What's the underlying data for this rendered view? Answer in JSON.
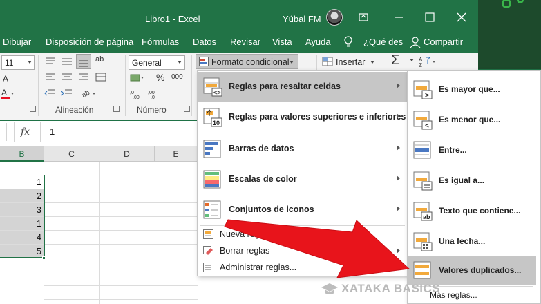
{
  "titlebar": {
    "title": "Libro1  -  Excel",
    "user": "Yúbal FM"
  },
  "tabs": [
    "Dibujar",
    "Disposición de página",
    "Fórmulas",
    "Datos",
    "Revisar",
    "Vista",
    "Ayuda",
    "¿Qué des",
    "Compartir"
  ],
  "ribbon": {
    "font_size": "11",
    "number_format": "General",
    "percent": "%",
    "thousands": "000",
    "ab_label": "ab",
    "group_alignment": "Alineación",
    "group_number": "Número",
    "cond_format_label": "Formato condicional",
    "insert_label": "Insertar",
    "sum_symbol": "Σ"
  },
  "formula_bar": {
    "fx": "fx",
    "value": "1"
  },
  "grid": {
    "columns": [
      "B",
      "C",
      "D",
      "E"
    ],
    "values": [
      "1",
      "2",
      "3",
      "1",
      "4",
      "5"
    ]
  },
  "menu1": {
    "items": [
      {
        "label": "Reglas para resaltar celdas",
        "icon": "highlight-rules-icon"
      },
      {
        "label": "Reglas para valores superiores e inferiores",
        "icon": "top-bottom-rules-icon"
      },
      {
        "label": "Barras de datos",
        "icon": "data-bars-icon"
      },
      {
        "label": "Escalas de color",
        "icon": "color-scales-icon"
      },
      {
        "label": "Conjuntos de iconos",
        "icon": "icon-sets-icon"
      }
    ],
    "small_items": [
      {
        "label": "Nueva regla...",
        "icon": "new-rule-icon"
      },
      {
        "label": "Borrar reglas",
        "icon": "clear-rules-icon"
      },
      {
        "label": "Administrar reglas...",
        "icon": "manage-rules-icon"
      }
    ]
  },
  "menu2": {
    "items": [
      {
        "label": "Es mayor que...",
        "icon": "greater-than-icon"
      },
      {
        "label": "Es menor que...",
        "icon": "less-than-icon"
      },
      {
        "label": "Entre...",
        "icon": "between-icon"
      },
      {
        "label": "Es igual a...",
        "icon": "equal-to-icon"
      },
      {
        "label": "Texto que contiene...",
        "icon": "text-contains-icon"
      },
      {
        "label": "Una fecha...",
        "icon": "date-occurring-icon"
      },
      {
        "label": "Valores duplicados...",
        "icon": "duplicate-values-icon"
      }
    ],
    "more": "Más reglas..."
  },
  "watermark": "XATAKA BASICS",
  "colors": {
    "excel_green": "#217346",
    "menu_highlight": "#c6c6c6",
    "arrow_red": "#e8141b"
  }
}
